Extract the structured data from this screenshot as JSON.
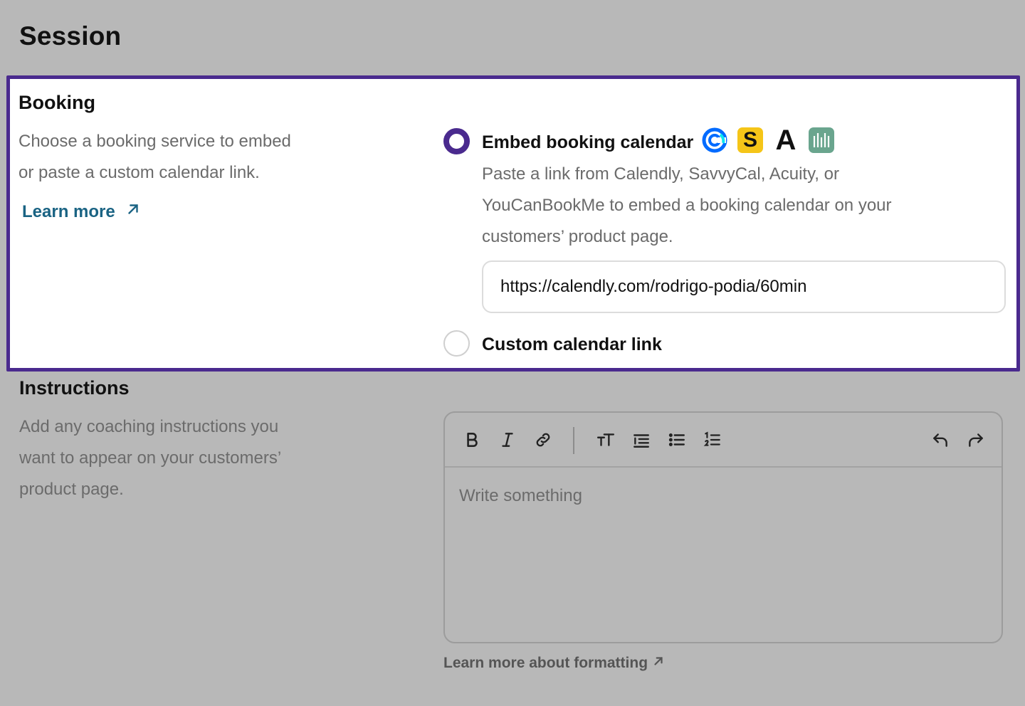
{
  "page": {
    "title": "Session"
  },
  "booking": {
    "heading": "Booking",
    "description_line1": "Choose a booking service to embed",
    "description_line2": "or paste a custom calendar link.",
    "learn_more_label": "Learn more",
    "options": [
      {
        "label": "Embed booking calendar",
        "selected": true,
        "description_line1": "Paste a link from Calendly, SavvyCal, Acuity, or",
        "description_line2": "YouCanBookMe to embed a booking calendar on your",
        "description_line3": "customers’ product page.",
        "url_value": "https://calendly.com/rodrigo-podia/60min",
        "service_icons": [
          "calendly-icon",
          "savvycal-icon",
          "acuity-icon",
          "youcanbookme-icon"
        ],
        "savvycal_letter": "S",
        "acuity_letter": "A"
      },
      {
        "label": "Custom calendar link",
        "selected": false
      }
    ]
  },
  "instructions": {
    "heading": "Instructions",
    "description_line1": "Add any coaching instructions you",
    "description_line2": "want to appear on your customers’",
    "description_line3": "product page.",
    "editor": {
      "placeholder": "Write something",
      "toolbar": [
        "bold-icon",
        "italic-icon",
        "link-icon",
        "text-size-icon",
        "indent-list-icon",
        "bullet-list-icon",
        "numbered-list-icon",
        "undo-icon",
        "redo-icon"
      ]
    },
    "formatting_link": "Learn more about formatting"
  },
  "colors": {
    "accent": "#4a2a8e",
    "link": "#1a6383",
    "overlay": "#b8b8b8"
  }
}
